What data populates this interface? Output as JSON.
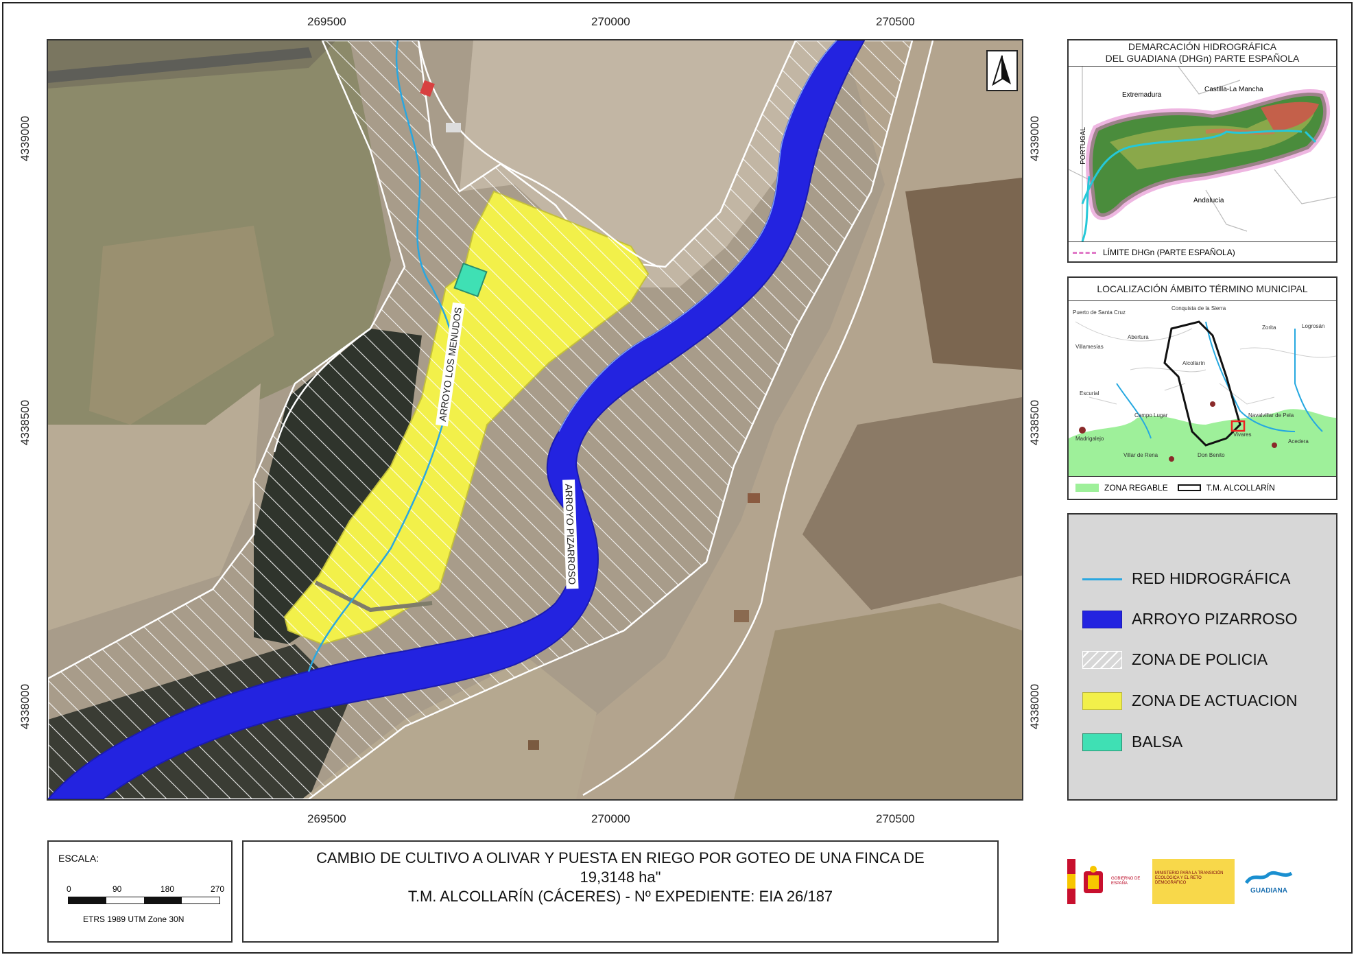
{
  "map": {
    "x_ticks": [
      "269500",
      "270000",
      "270500"
    ],
    "y_ticks": [
      "4339000",
      "4338500",
      "4338000"
    ],
    "north_arrow": "north-arrow-icon",
    "labels": {
      "arroyo_menudos": "ARROYO LOS MENUDOS",
      "arroyo_pizarroso": "ARROYO PIZARROSO"
    }
  },
  "inset_demarcacion": {
    "title_line1": "DEMARCACIÓN HIDROGRÁFICA",
    "title_line2": "DEL GUADIANA (DHGn) PARTE ESPAÑOLA",
    "regions": [
      "Extremadura",
      "Castilla-La Mancha",
      "Andalucía",
      "PORTUGAL"
    ],
    "legend_label": "LÍMITE DHGn (PARTE ESPAÑOLA)"
  },
  "inset_localizacion": {
    "title": "LOCALIZACIÓN ÁMBITO TÉRMINO MUNICIPAL",
    "places": [
      "Puerto de Santa Cruz",
      "Conquista de la Sierra",
      "Zorita",
      "Logrosán",
      "Abertura",
      "Villamesías",
      "Alcollarín",
      "Escurial",
      "Campo Lugar",
      "Navalvillar de Pela",
      "Madrigalejo",
      "Villar de Rena",
      "Don Benito",
      "Acedera",
      "Vivares"
    ],
    "legend_zona": "ZONA REGABLE",
    "legend_tm": "T.M. ALCOLLARÍN"
  },
  "legend": {
    "items": [
      {
        "label": "RED HIDROGRÁFICA",
        "color": "#2aa7e0"
      },
      {
        "label": "ARROYO PIZARROSO",
        "color": "#2323e0"
      },
      {
        "label": "ZONA DE POLICIA",
        "color": "#ffffff"
      },
      {
        "label": "ZONA DE ACTUACION",
        "color": "#f2f04a"
      },
      {
        "label": "BALSA",
        "color": "#3fe0b4"
      }
    ]
  },
  "scale": {
    "label": "ESCALA:",
    "ticks": [
      "0",
      "90",
      "180",
      "270 m"
    ],
    "projection": "ETRS 1989 UTM Zone 30N"
  },
  "title": {
    "line1": "CAMBIO DE CULTIVO A OLIVAR Y PUESTA EN RIEGO POR GOTEO DE UNA FINCA DE",
    "line2": "19,3148  ha\"",
    "line3": "T.M. ALCOLLARÍN (CÁCERES)  -  Nº EXPEDIENTE: EIA 26/187"
  },
  "logos": {
    "gobierno": "GOBIERNO DE ESPAÑA",
    "ministerio": "MINISTERIO PARA LA TRANSICIÓN ECOLÓGICA Y EL RETO DEMOGRÁFICO",
    "chg": "GUADIANA"
  }
}
